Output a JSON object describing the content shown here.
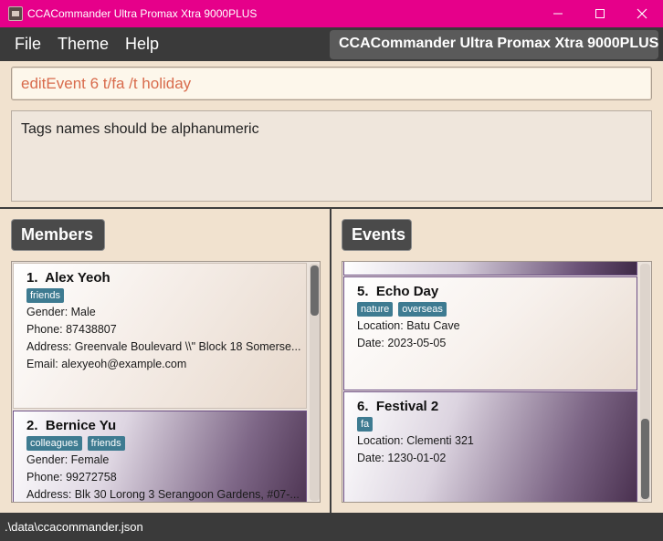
{
  "window": {
    "title": "CCACommander Ultra Promax Xtra 9000PLUS",
    "accent_color": "#e6008a"
  },
  "menu": {
    "items": [
      "File",
      "Theme",
      "Help"
    ],
    "app_name": "CCACommander Ultra Promax Xtra 9000PLUS"
  },
  "command": {
    "value": "editEvent 6 t/fa  /t holiday",
    "text_color": "#d86b4c"
  },
  "result": {
    "message": "Tags names should be alphanumeric"
  },
  "members": {
    "header": "Members",
    "cards": [
      {
        "index": "1.",
        "name": "Alex Yeoh",
        "tags": [
          "friends"
        ],
        "gender": "Gender: Male",
        "phone": "Phone: 87438807",
        "address": "Address: Greenvale Boulevard \\\\\" Block 18 Somerse...",
        "email": "Email: alexyeoh@example.com"
      },
      {
        "index": "2.",
        "name": "Bernice Yu",
        "tags": [
          "colleagues",
          "friends"
        ],
        "gender": "Gender: Female",
        "phone": "Phone: 99272758",
        "address": "Address: Blk 30 Lorong 3 Serangoon Gardens, #07-..."
      }
    ]
  },
  "events": {
    "header": "Events",
    "cards": [
      {
        "index": "5.",
        "name": "Echo Day",
        "tags": [
          "nature",
          "overseas"
        ],
        "location": "Location: Batu Cave",
        "date": "Date: 2023-05-05"
      },
      {
        "index": "6.",
        "name": "Festival 2",
        "tags": [
          "fa"
        ],
        "location": "Location: Clementi 321",
        "date": "Date: 1230-01-02"
      }
    ]
  },
  "status": {
    "file_path": ".\\data\\ccacommander.json"
  },
  "icons": [
    "app-icon",
    "minimize-icon",
    "maximize-icon",
    "close-icon"
  ]
}
